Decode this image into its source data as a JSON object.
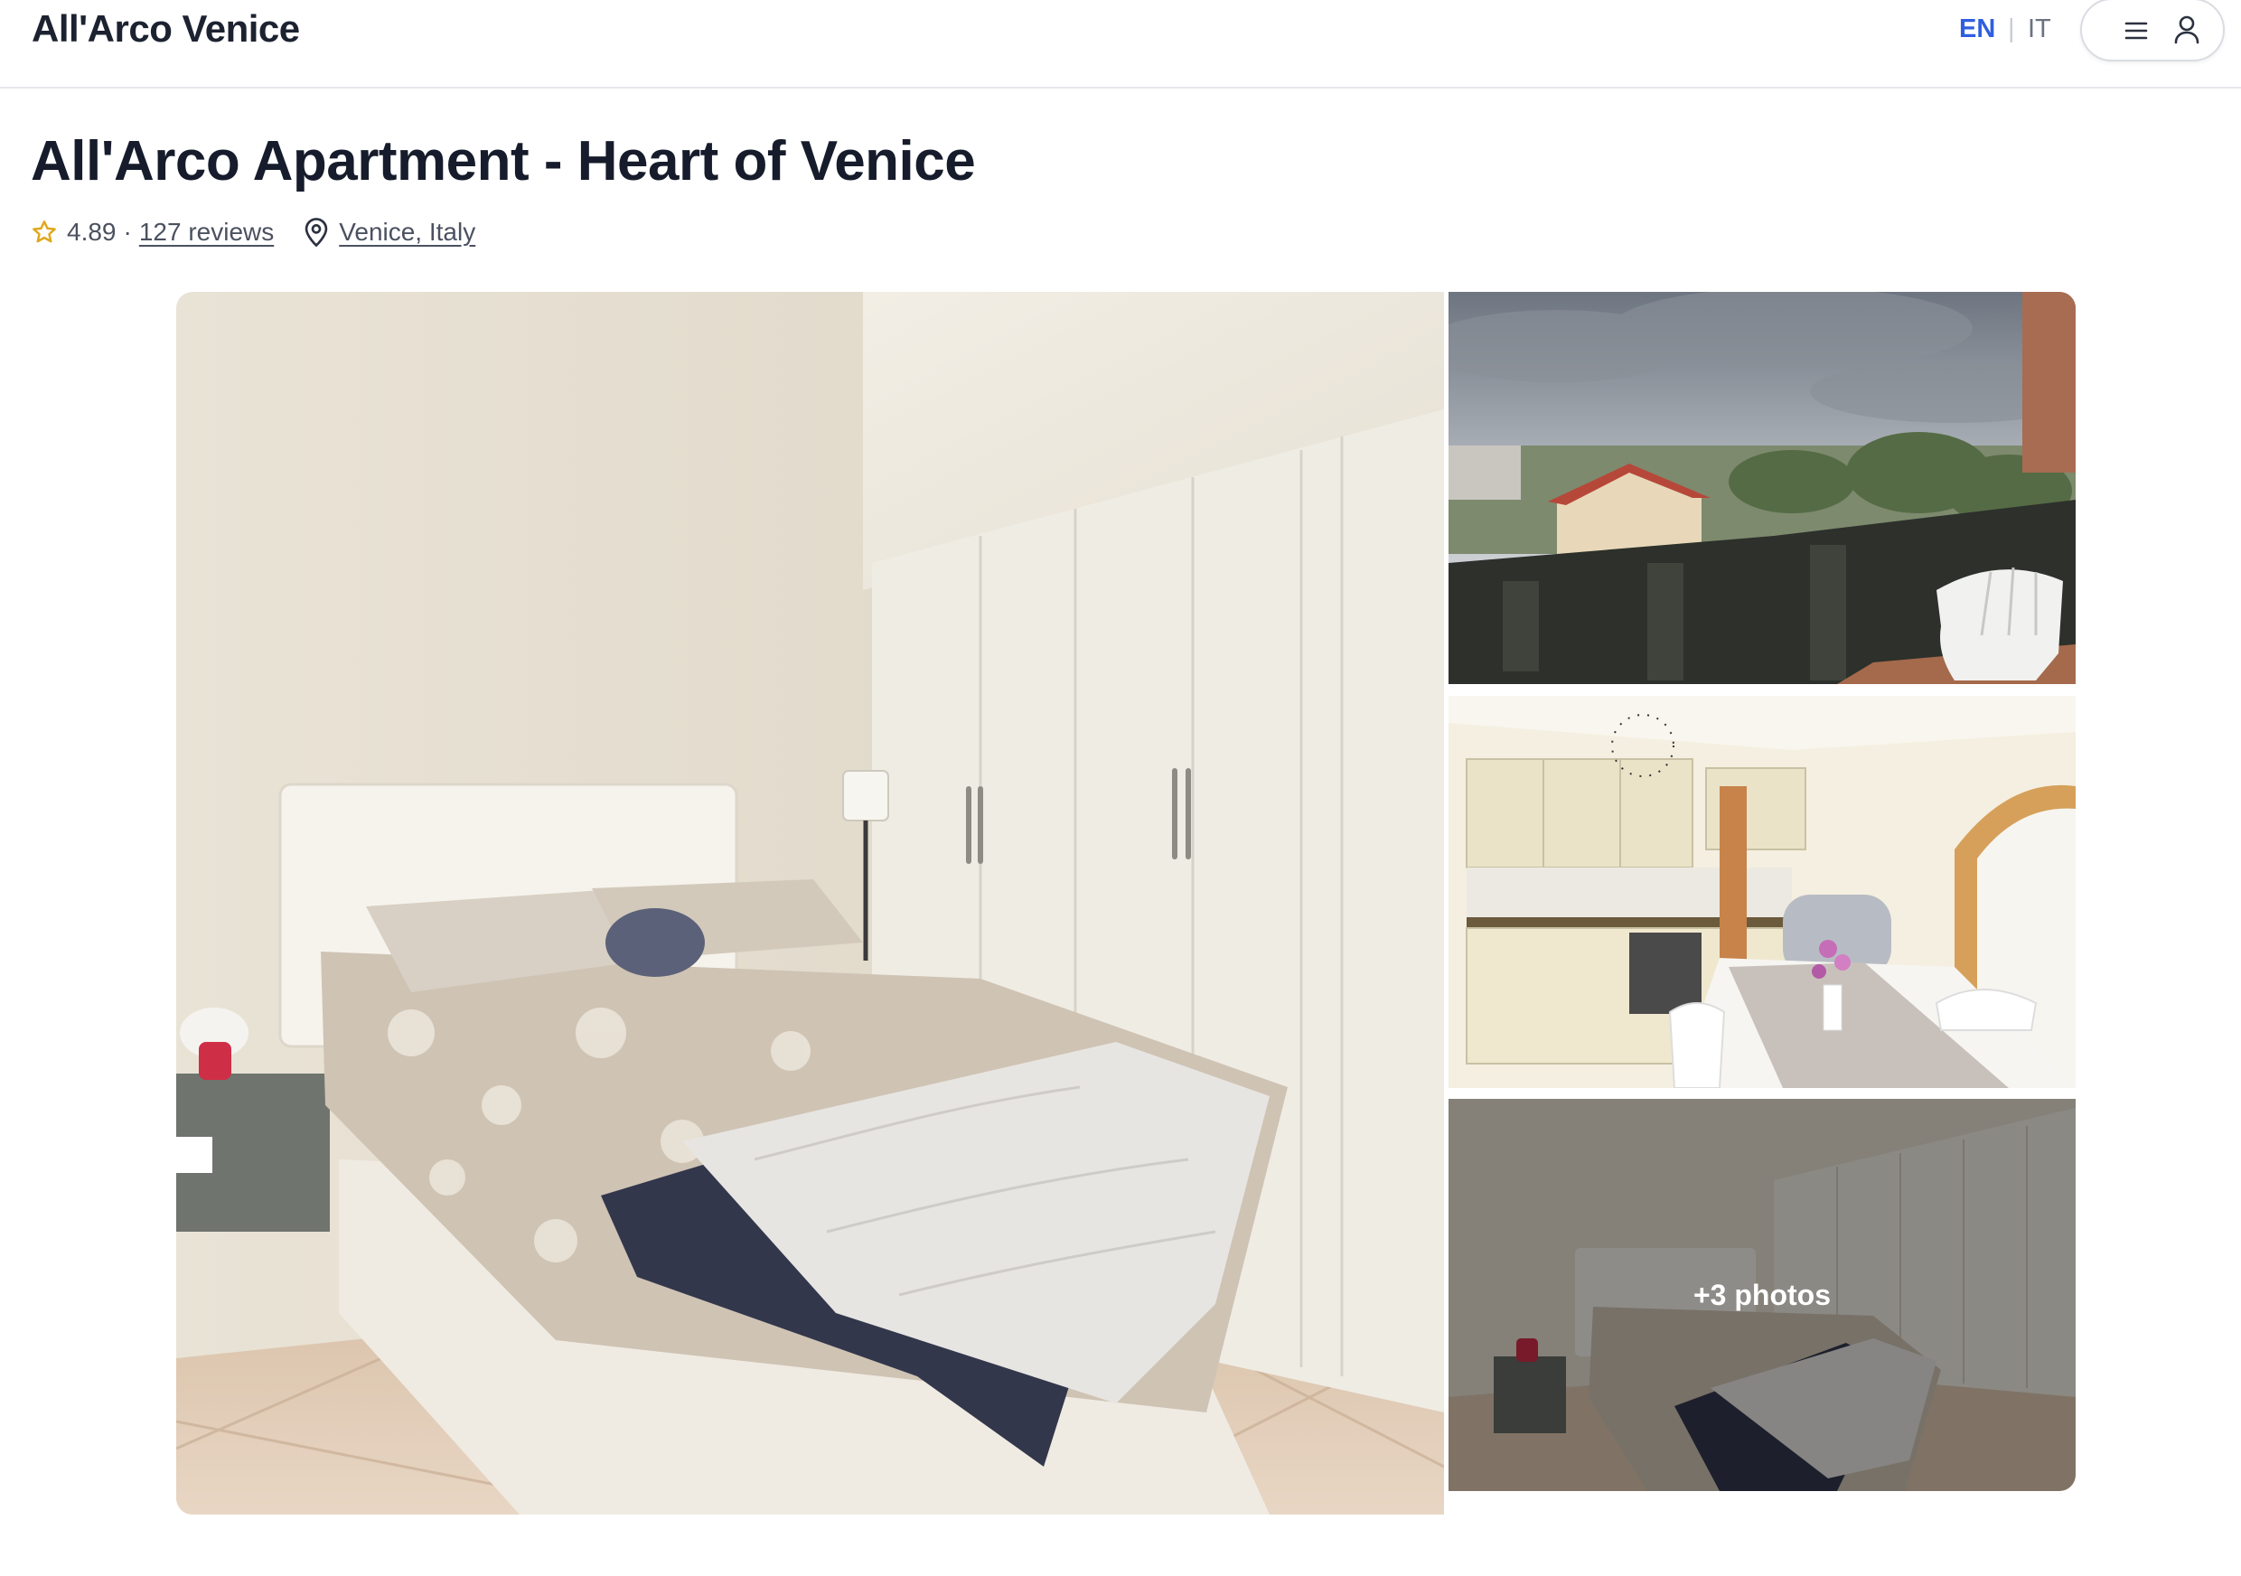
{
  "header": {
    "brand": "All'Arco Venice",
    "lang_en": "EN",
    "lang_sep": "|",
    "lang_it": "IT",
    "menu_icon": "hamburger-icon",
    "user_icon": "user-icon"
  },
  "listing": {
    "title": "All'Arco Apartment - Heart of Venice",
    "rating": "4.89",
    "separator": "·",
    "reviews": "127 reviews",
    "location": "Venice, Italy"
  },
  "gallery": {
    "more_photos": "+3 photos",
    "photos": [
      "bedroom",
      "balcony view",
      "kitchen and dining area",
      "bedroom wardrobe"
    ]
  },
  "colors": {
    "accent": "#2f5fe0",
    "star": "#e0a81c",
    "text": "#161c2b",
    "muted": "#4b5160"
  }
}
